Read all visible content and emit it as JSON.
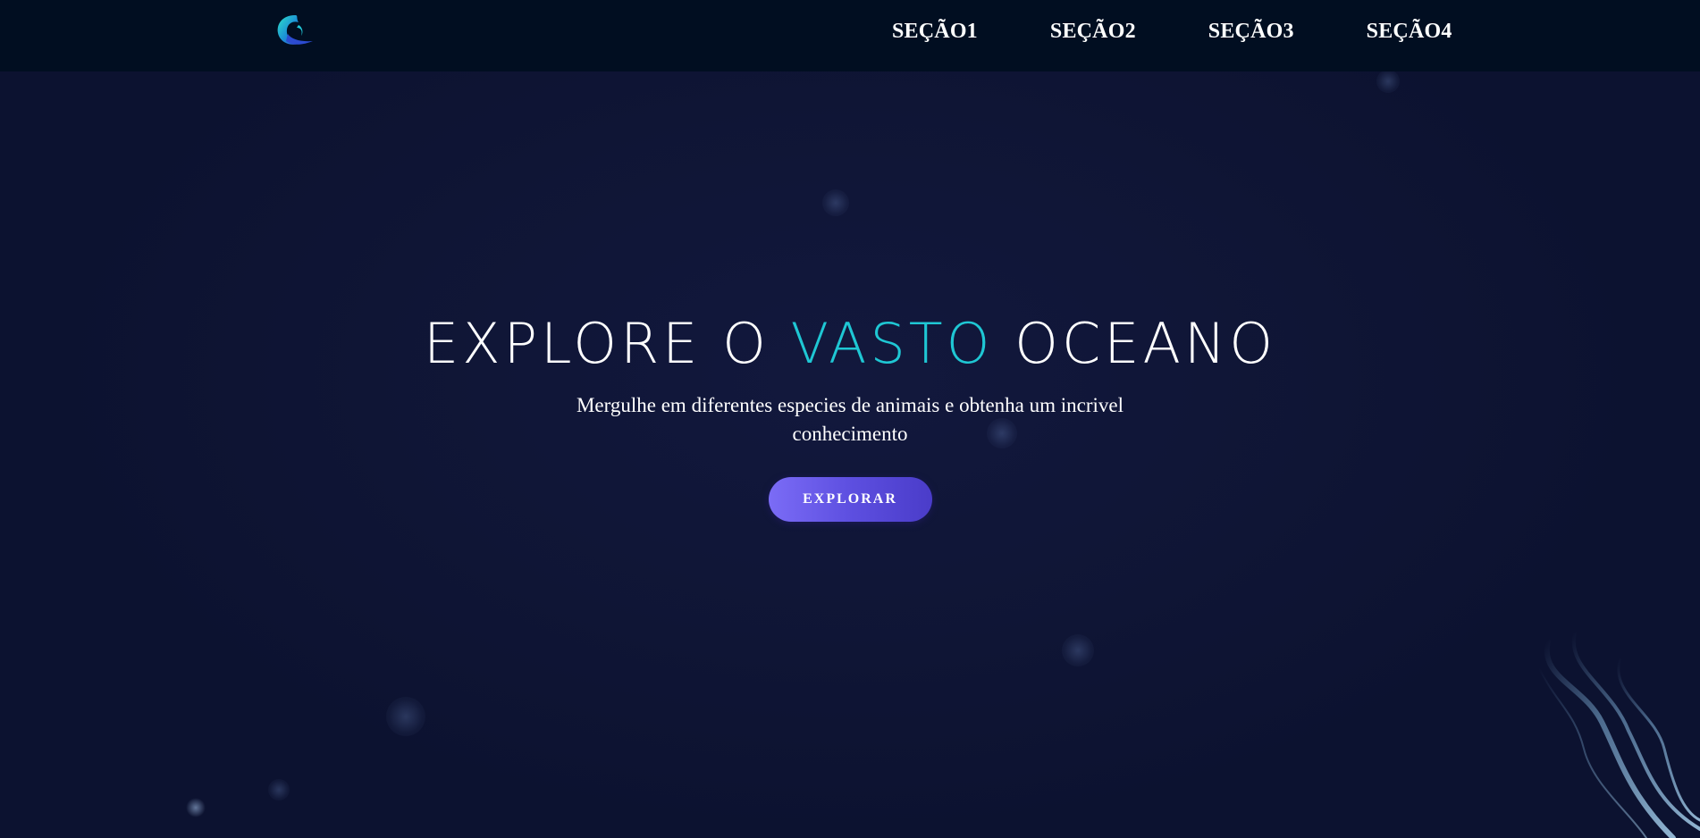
{
  "navbar": {
    "logo_name": "wave-logo-icon",
    "links": [
      {
        "label": "SEÇÃO1"
      },
      {
        "label": "SEÇÃO2"
      },
      {
        "label": "SEÇÃO3"
      },
      {
        "label": "SEÇÃO4"
      }
    ]
  },
  "hero": {
    "title_part1": "EXPLORE O ",
    "title_accent": "VASTO",
    "title_part2": " OCEANO",
    "subtitle": "Mergulhe em diferentes especies de animais e obtenha um incrivel conhecimento",
    "button_label": "EXPLORAR"
  },
  "colors": {
    "background": "#0f1535",
    "navbar": "#010e21",
    "accent": "#1fc7d4",
    "button_start": "#7b6cf6",
    "button_end": "#4a3cc9"
  }
}
